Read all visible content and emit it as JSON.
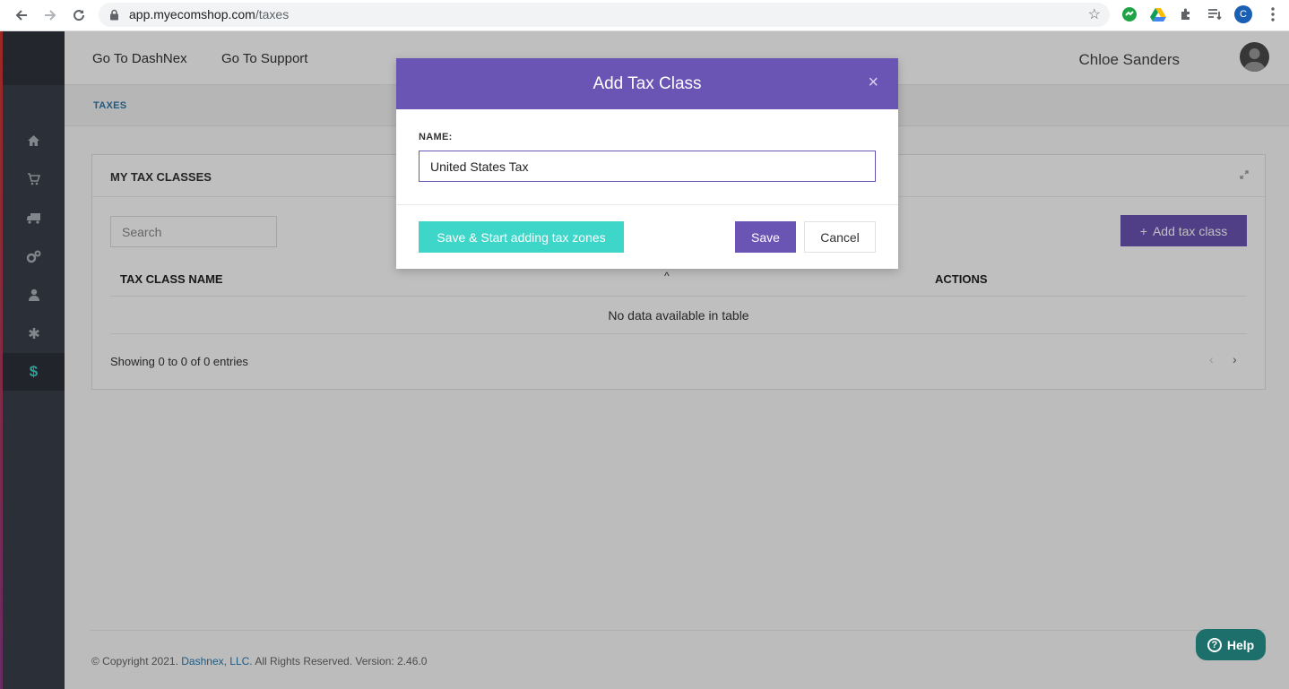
{
  "browser": {
    "url_host": "app.myecomshop.com",
    "url_path": "/taxes",
    "profile_initial": "C"
  },
  "topbar": {
    "link_dashnex": "Go To DashNex",
    "link_support": "Go To Support",
    "user_name": "Chloe Sanders"
  },
  "sidebar": {
    "items": [
      {
        "icon": "home-icon"
      },
      {
        "icon": "cart-icon"
      },
      {
        "icon": "truck-icon"
      },
      {
        "icon": "gears-icon"
      },
      {
        "icon": "user-icon"
      },
      {
        "icon": "asterisk-icon"
      },
      {
        "icon": "dollar-icon",
        "active": true
      }
    ]
  },
  "breadcrumb": "TAXES",
  "panel": {
    "title": "MY TAX CLASSES",
    "search_placeholder": "Search",
    "add_button": "Add tax class",
    "columns": [
      "TAX CLASS NAME",
      "ACTIONS"
    ],
    "empty_message": "No data available in table",
    "showing": "Showing 0 to 0 of 0 entries"
  },
  "footer": {
    "prefix": "© Copyright 2021.",
    "company": "Dashnex, LLC.",
    "suffix": "All Rights Reserved. Version: 2.46.0"
  },
  "help": {
    "label": "Help"
  },
  "modal": {
    "title": "Add Tax Class",
    "field_label": "NAME:",
    "name_value": "United States Tax",
    "save_start_label": "Save & Start adding tax zones",
    "save_label": "Save",
    "cancel_label": "Cancel"
  },
  "colors": {
    "accent": "#6b55b4",
    "teal": "#3ed6c8",
    "link": "#2a7ab0",
    "sidebar": "#3a3f4b"
  }
}
